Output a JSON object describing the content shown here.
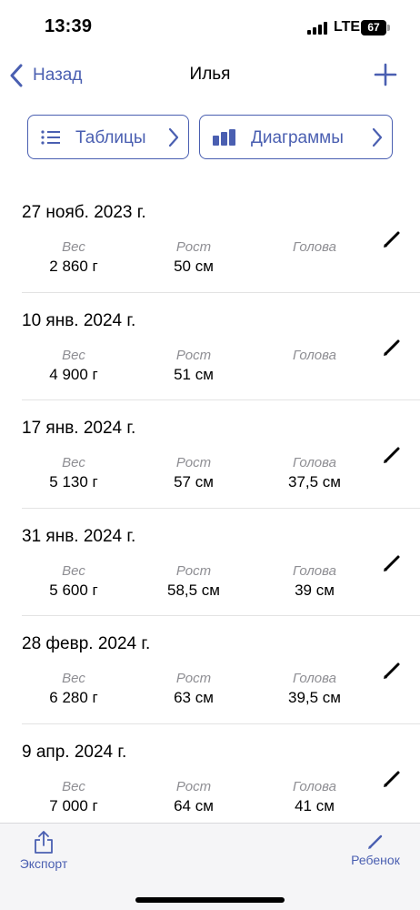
{
  "status": {
    "time": "13:39",
    "network": "LTE",
    "battery": "67"
  },
  "nav": {
    "back_label": "Назад",
    "title": "Илья"
  },
  "segments": {
    "tables_label": "Таблицы",
    "charts_label": "Диаграммы"
  },
  "labels": {
    "weight": "Вес",
    "height": "Рост",
    "head": "Голова"
  },
  "entries": [
    {
      "date": "27 нояб. 2023 г.",
      "weight": "2 860 г",
      "height": "50 см",
      "head": ""
    },
    {
      "date": "10 янв. 2024 г.",
      "weight": "4 900 г",
      "height": "51 см",
      "head": ""
    },
    {
      "date": "17 янв. 2024 г.",
      "weight": "5 130 г",
      "height": "57 см",
      "head": "37,5 см"
    },
    {
      "date": "31 янв. 2024 г.",
      "weight": "5 600 г",
      "height": "58,5 см",
      "head": "39 см"
    },
    {
      "date": "28 февр. 2024 г.",
      "weight": "6 280 г",
      "height": "63 см",
      "head": "39,5 см"
    },
    {
      "date": "9 апр. 2024 г.",
      "weight": "7 000 г",
      "height": "64 см",
      "head": "41 см"
    }
  ],
  "toolbar": {
    "export_label": "Экспорт",
    "child_label": "Ребенок"
  },
  "colors": {
    "accent": "#4a5fb1",
    "secondary_text": "#8e8e93",
    "separator": "#e3e3e3",
    "toolbar_bg": "#f5f5f7"
  }
}
